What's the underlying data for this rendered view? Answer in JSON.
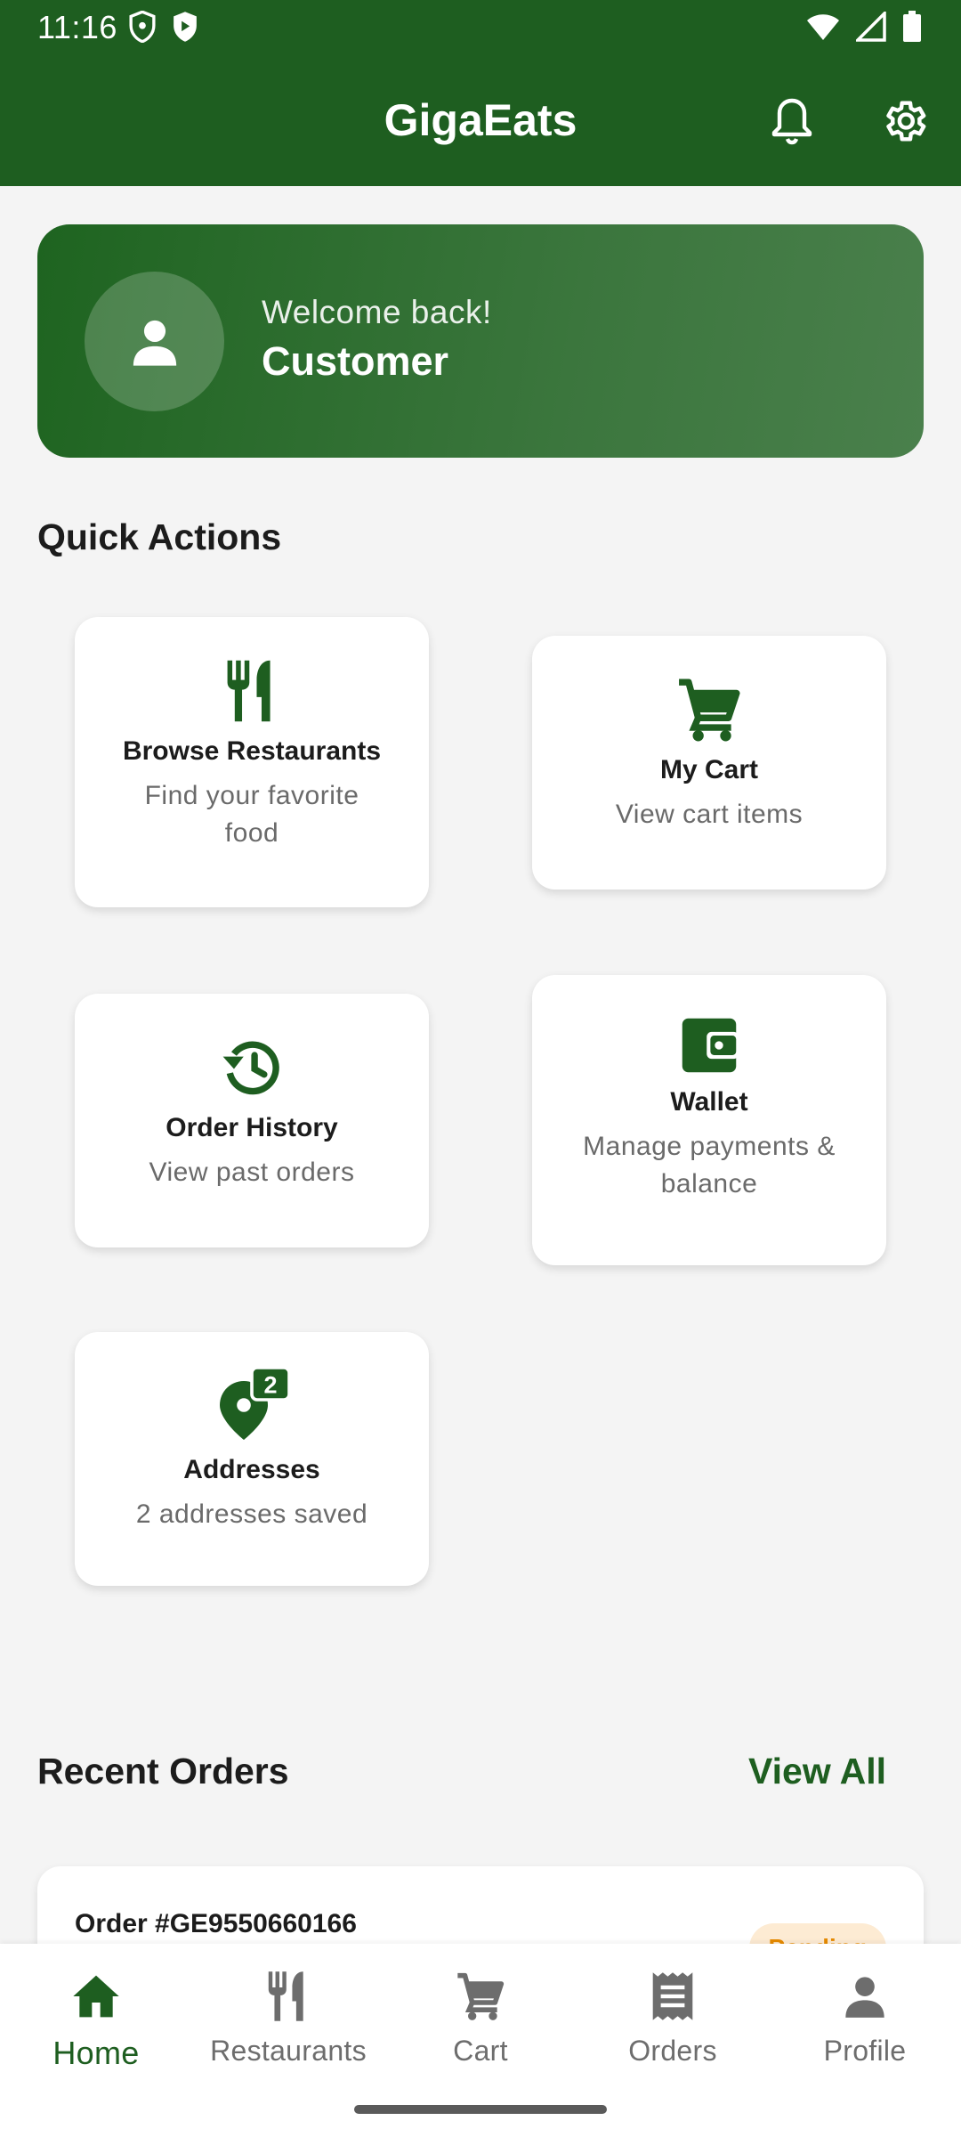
{
  "status_bar": {
    "time": "11:16"
  },
  "app_bar": {
    "title": "GigaEats"
  },
  "welcome": {
    "greeting": "Welcome back!",
    "name": "Customer"
  },
  "quick_actions": {
    "title": "Quick Actions",
    "items": [
      {
        "icon": "restaurant-icon",
        "title": "Browse Restaurants",
        "subtitle": "Find your favorite food"
      },
      {
        "icon": "cart-icon",
        "title": "My Cart",
        "subtitle": "View cart items"
      },
      {
        "icon": "history-icon",
        "title": "Order History",
        "subtitle": "View past orders"
      },
      {
        "icon": "wallet-icon",
        "title": "Wallet",
        "subtitle": "Manage payments & balance"
      },
      {
        "icon": "location-pin-icon",
        "title": "Addresses",
        "subtitle": "2 addresses saved",
        "badge": "2"
      }
    ]
  },
  "recent_orders": {
    "title": "Recent Orders",
    "view_all": "View All",
    "orders": [
      {
        "id": "Order #GE9550660166",
        "status": "Pending"
      }
    ]
  },
  "bottom_nav": {
    "items": [
      {
        "label": "Home",
        "icon": "home-icon",
        "active": true
      },
      {
        "label": "Restaurants",
        "icon": "restaurant-icon"
      },
      {
        "label": "Cart",
        "icon": "cart-icon"
      },
      {
        "label": "Orders",
        "icon": "receipt-icon"
      },
      {
        "label": "Profile",
        "icon": "person-icon"
      }
    ]
  },
  "colors": {
    "primary": "#1e5e20",
    "background": "#f4f4f4",
    "pending_bg": "#fdebd3",
    "pending_text": "#e68a00"
  }
}
